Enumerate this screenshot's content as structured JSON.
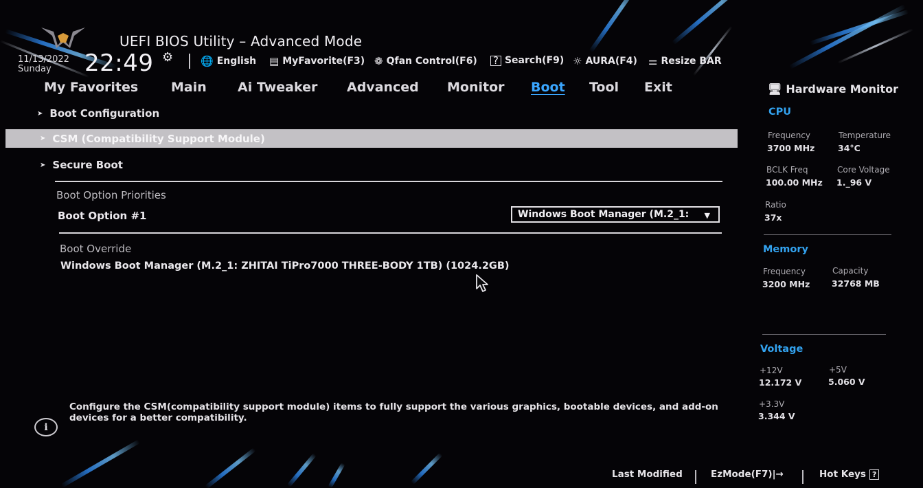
{
  "header": {
    "title": "UEFI BIOS Utility – Advanced Mode",
    "date": "11/13/2022",
    "day": "Sunday",
    "time": "22:49",
    "toolbar": [
      {
        "icon": "globe-icon",
        "label": "English"
      },
      {
        "icon": "myfavorite-icon",
        "label": "MyFavorite(F3)"
      },
      {
        "icon": "fan-icon",
        "label": "Qfan Control(F6)"
      },
      {
        "icon": "search-question-icon",
        "label": "Search(F9)"
      },
      {
        "icon": "aura-icon",
        "label": "AURA(F4)"
      },
      {
        "icon": "resize-bar-icon",
        "label": "Resize BAR"
      }
    ]
  },
  "nav": {
    "tabs": [
      "My Favorites",
      "Main",
      "Ai Tweaker",
      "Advanced",
      "Monitor",
      "Boot",
      "Tool",
      "Exit"
    ],
    "active": "Boot"
  },
  "boot": {
    "items": [
      "Boot Configuration",
      "CSM (Compatibility Support Module)",
      "Secure Boot"
    ],
    "selected": "CSM (Compatibility Support Module)",
    "priorities_label": "Boot Option Priorities",
    "option1_label": "Boot Option #1",
    "option1_value": "Windows Boot Manager (M.2_1:",
    "override_label": "Boot Override",
    "override_item": "Windows Boot Manager (M.2_1: ZHITAI TiPro7000 THREE-BODY 1TB) (1024.2GB)"
  },
  "help": {
    "text": "Configure the CSM(compatibility support module) items to fully support the various graphics, bootable devices, and add-on devices for a better compatibility."
  },
  "footer": {
    "last_modified": "Last Modified",
    "ezmode": "EzMode(F7)|→",
    "hotkeys": "Hot Keys"
  },
  "hardware_monitor": {
    "title": "Hardware Monitor",
    "cpu": {
      "heading": "CPU",
      "frequency_label": "Frequency",
      "frequency": "3700 MHz",
      "temperature_label": "Temperature",
      "temperature": "34°C",
      "bclk_label": "BCLK Freq",
      "bclk": "100.00 MHz",
      "core_voltage_label": "Core Voltage",
      "core_voltage": "1._96 V",
      "ratio_label": "Ratio",
      "ratio": "37x"
    },
    "memory": {
      "heading": "Memory",
      "frequency_label": "Frequency",
      "frequency": "3200 MHz",
      "capacity_label": "Capacity",
      "capacity": "32768 MB"
    },
    "voltage": {
      "heading": "Voltage",
      "v12_label": "+12V",
      "v12": "12.172 V",
      "v5_label": "+5V",
      "v5": "5.060 V",
      "v33_label": "+3.3V",
      "v33": "3.344 V"
    }
  },
  "colors": {
    "accent": "#33a3f0",
    "active_tab": "#3aa6ff",
    "highlight_row": "#c3c1c5",
    "background": "#050407"
  }
}
